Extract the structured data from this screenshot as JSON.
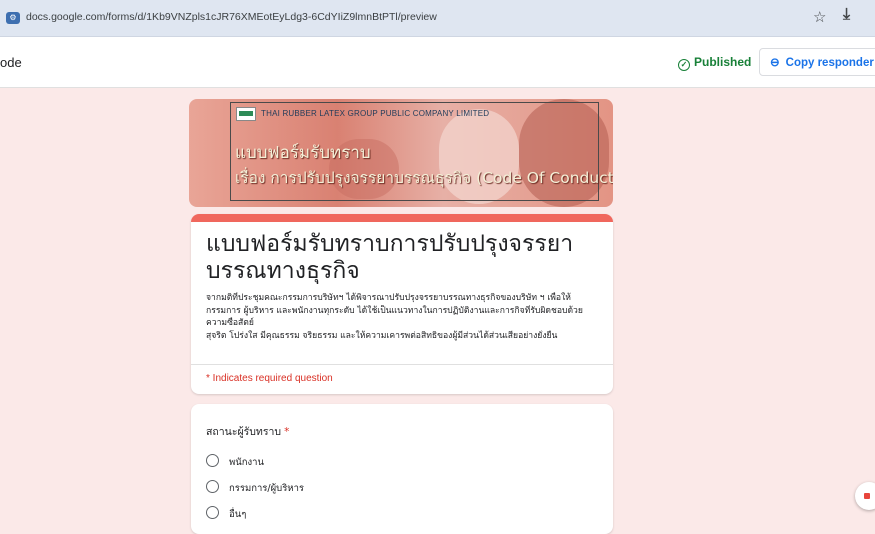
{
  "browser": {
    "url": "docs.google.com/forms/d/1Kb9VNZpls1cJR76XMEotEyLdg3-6CdYIiZ9lmnBtPTl/preview"
  },
  "header": {
    "mode_label": "ode",
    "published_label": "Published",
    "copy_link_label": "Copy responder link"
  },
  "banner": {
    "company": "THAI RUBBER LATEX GROUP PUBLIC COMPANY LIMITED",
    "title_line1": "แบบฟอร์มรับทราบ",
    "title_line2": "เรื่อง การปรับปรุงจรรยาบรรณธุรกิจ (Code Of Conduct)"
  },
  "form": {
    "title": "แบบฟอร์มรับทราบการปรับปรุงจรรยาบรรณทางธุรกิจ",
    "description_lines": [
      "จากมติที่ประชุมคณะกรรมการบริษัทฯ ได้พิจารณาปรับปรุงจรรยาบรรณทางธุรกิจของบริษัท ฯ เพื่อให้",
      "กรรมการ ผู้บริหาร และพนักงานทุกระดับ ได้ใช้เป็นแนวทางในการปฏิบัติงานและการกิจที่รับผิดชอบด้วย",
      "ความซื่อสัตย์",
      "สุจริต โปร่งใส มีคุณธรรม จริยธรรม และให้ความเคารพต่อสิทธิของผู้มีส่วนได้ส่วนเสียอย่างยั่งยืน"
    ],
    "required_note": "* Indicates required question"
  },
  "question": {
    "title": "สถานะผู้รับทราบ",
    "required_mark": "*",
    "options": [
      "พนักงาน",
      "กรรมการ/ผู้บริหาร",
      "อื่นๆ"
    ]
  },
  "colors": {
    "accent": "#f0675d",
    "background": "#fbe9e8",
    "published": "#188038",
    "link": "#1a73e8"
  }
}
